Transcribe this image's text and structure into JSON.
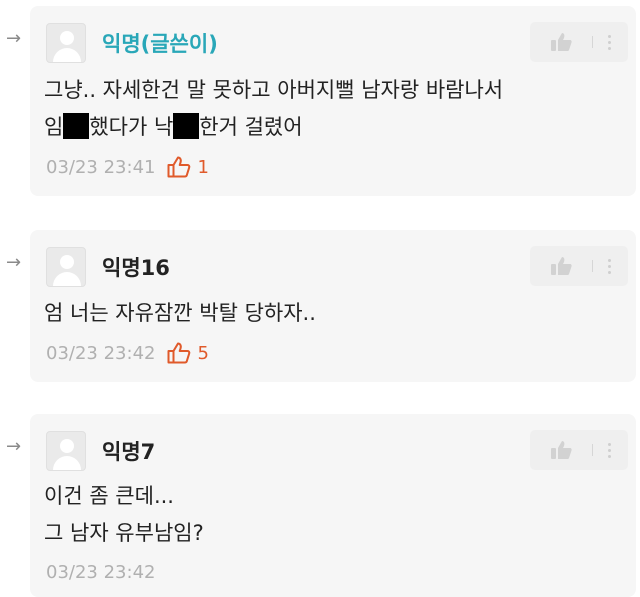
{
  "comments": [
    {
      "author": "익명(글쓴이)",
      "line1": "그냥.. 자세한건 말 못하고 아버지뻘 남자랑 바람나서",
      "line2_a": "임",
      "line2_b": "했다가 낙",
      "line2_c": "한거 걸렸어",
      "timestamp": "03/23 23:41",
      "likes": "1"
    },
    {
      "author": "익명16",
      "line1": "엄 너는 자유잠깐 박탈 당하자..",
      "timestamp": "03/23 23:42",
      "likes": "5"
    },
    {
      "author": "익명7",
      "line1": "이건 좀 큰데...",
      "line2": "그 남자 유부남임?",
      "timestamp": "03/23 23:42"
    }
  ],
  "icons": {
    "reply_arrow": "reply-arrow-icon",
    "like": "thumbs-up-icon",
    "more": "more-vertical-icon"
  },
  "colors": {
    "writer_name": "#29a7b8",
    "like_count": "#e05a2b",
    "card_bg": "#f6f6f6"
  }
}
